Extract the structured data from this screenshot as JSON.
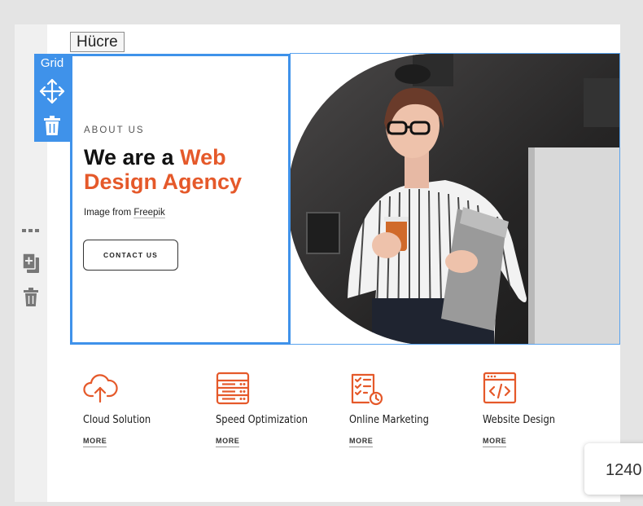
{
  "editor": {
    "cell_tag": "Hücre",
    "grid_label": "Grid",
    "width_value": "1240",
    "accent_color": "#3f92ea"
  },
  "rail": {
    "icons": [
      "more-dots-icon",
      "duplicate-icon",
      "trash-icon"
    ]
  },
  "hero": {
    "eyebrow": "ABOUT US",
    "headline_plain": "We are a ",
    "headline_accent": "Web Design Agency",
    "credit_prefix": "Image from ",
    "credit_link": "Freepik",
    "button_label": "CONTACT US",
    "accent_color": "#e5592a"
  },
  "services": [
    {
      "icon": "cloud-upload-icon",
      "title": "Cloud Solution",
      "more": "MORE"
    },
    {
      "icon": "server-stack-icon",
      "title": "Speed Optimization",
      "more": "MORE"
    },
    {
      "icon": "checklist-clock-icon",
      "title": "Online Marketing",
      "more": "MORE"
    },
    {
      "icon": "browser-code-icon",
      "title": "Website Design",
      "more": "MORE"
    }
  ]
}
